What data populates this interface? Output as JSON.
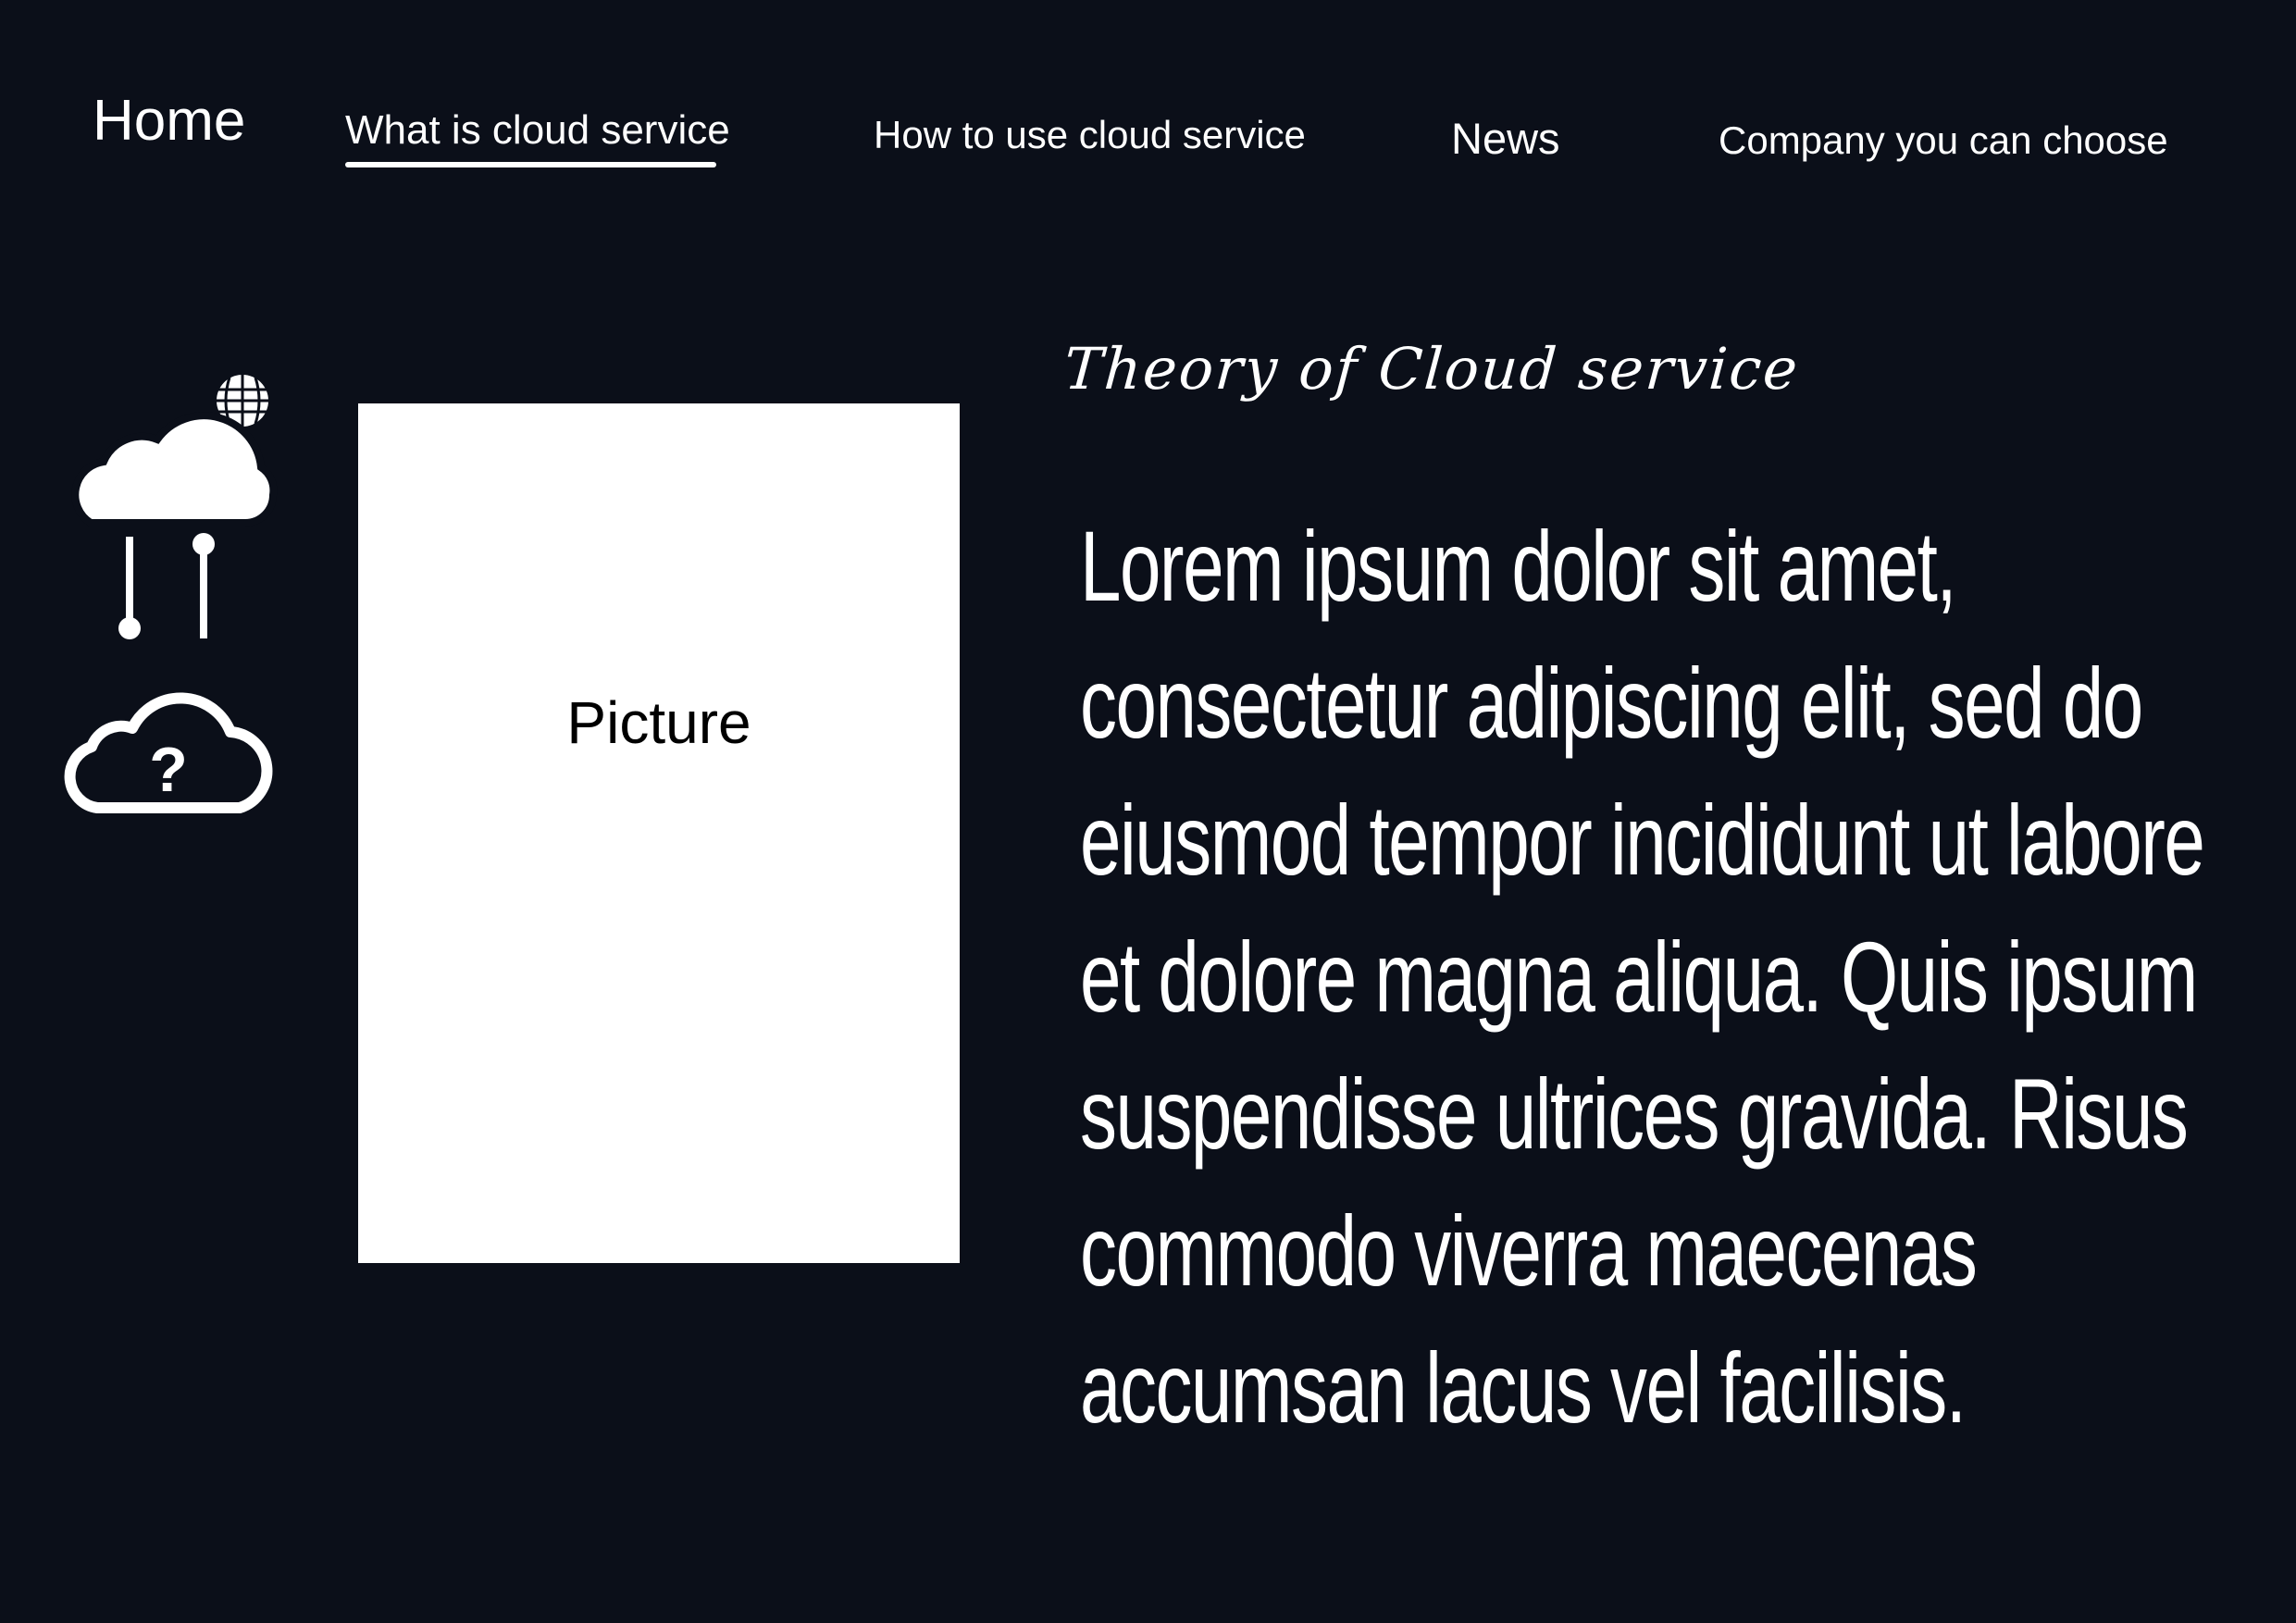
{
  "nav": {
    "home": "Home",
    "what_is": "What is cloud service",
    "how_to": "How to use cloud service",
    "news": "News",
    "company": "Company you can choose",
    "active": "what_is"
  },
  "sidebar_icons": [
    "cloud-network-icon",
    "cloud-question-icon"
  ],
  "picture": {
    "label": "Picture"
  },
  "section": {
    "title": "Theory of Cloud service",
    "body": "Lorem ipsum dolor sit amet, consectetur adipiscing elit, sed do eiusmod tempor incididunt ut labore et dolore magna aliqua. Quis ipsum suspendisse ultrices gravida. Risus commodo viverra maecenas accumsan lacus vel facilisis."
  },
  "colors": {
    "background": "#0b0f19",
    "foreground": "#ffffff",
    "picture_bg": "#ffffff",
    "picture_text": "#000000"
  }
}
